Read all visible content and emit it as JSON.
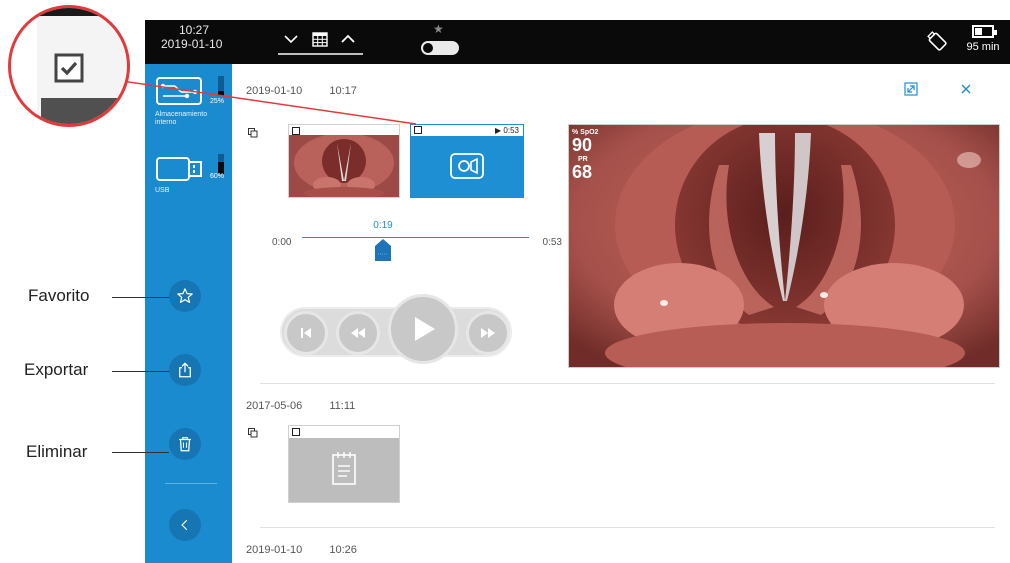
{
  "status_bar": {
    "time": "10:27",
    "date": "2019-01-10",
    "battery_text": "95 min",
    "battery_level_fraction": 0.45
  },
  "sidebar": {
    "storage": [
      {
        "label": "Almacenamiento interno",
        "percent": "25%",
        "fill_fraction": 0.25
      },
      {
        "label": "USB",
        "percent": "60%",
        "fill_fraction": 0.6
      }
    ],
    "buttons": [
      "star-icon",
      "export-icon",
      "trash-icon",
      "chevron-left-icon"
    ]
  },
  "callouts": {
    "favorite": "Favorito",
    "export": "Exportar",
    "delete": "Eliminar"
  },
  "records": [
    {
      "date": "2019-01-10",
      "time": "10:17"
    },
    {
      "date": "2017-05-06",
      "time": "11:11"
    },
    {
      "date": "2019-01-10",
      "time": "10:26"
    }
  ],
  "video_thumb": {
    "duration": "▶ 0:53"
  },
  "player": {
    "start": "0:00",
    "current": "0:19",
    "end": "0:53",
    "progress_fraction": 0.358
  },
  "vitals": {
    "spo2_label": "% SpO2",
    "spo2_value": "90",
    "pr_label": "PR",
    "pr_value": "68"
  },
  "colors": {
    "sidebar_blue": "#1b8bd0",
    "accent_blue": "#1f8fd4",
    "callout_red": "#e23a3a",
    "top_bar": "#0a0a0a"
  }
}
